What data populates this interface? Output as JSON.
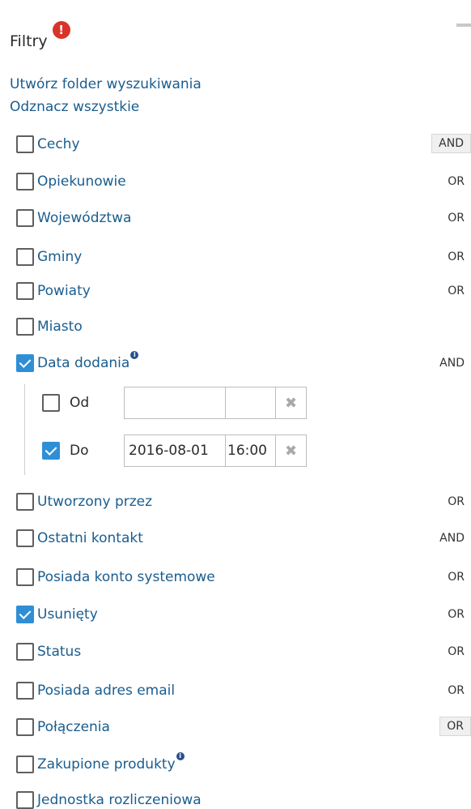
{
  "header": {
    "title": "Filtry",
    "alert_symbol": "!"
  },
  "links": {
    "create_folder": "Utwórz folder wyszukiwania",
    "uncheck_all": "Odznacz wszystkie"
  },
  "filters": [
    {
      "label": "Cechy",
      "checked": false,
      "op": "AND",
      "op_boxed": true
    },
    {
      "label": "Opiekunowie",
      "checked": false,
      "op": "OR"
    },
    {
      "label": "Województwa",
      "checked": false,
      "op": "OR"
    },
    {
      "label": "Gminy",
      "checked": false,
      "op": "OR"
    },
    {
      "label": "Powiaty",
      "checked": false,
      "op": "OR"
    },
    {
      "label": "Miasto",
      "checked": false,
      "op": ""
    },
    {
      "label": "Data dodania",
      "checked": true,
      "op": "AND",
      "info": true
    },
    {
      "label": "Utworzony przez",
      "checked": false,
      "op": "OR"
    },
    {
      "label": "Ostatni kontakt",
      "checked": false,
      "op": "AND"
    },
    {
      "label": "Posiada konto systemowe",
      "checked": false,
      "op": "OR"
    },
    {
      "label": "Usunięty",
      "checked": true,
      "op": "OR"
    },
    {
      "label": "Status",
      "checked": false,
      "op": "OR"
    },
    {
      "label": "Posiada adres email",
      "checked": false,
      "op": "OR"
    },
    {
      "label": "Połączenia",
      "checked": false,
      "op": "OR",
      "op_boxed": true
    },
    {
      "label": "Zakupione produkty",
      "checked": false,
      "op": "",
      "info": true
    },
    {
      "label": "Jednostka rozliczeniowa",
      "checked": false,
      "op": ""
    }
  ],
  "date_range": {
    "from": {
      "label": "Od",
      "checked": false,
      "date": "",
      "time": ""
    },
    "to": {
      "label": "Do",
      "checked": true,
      "date": "2016-08-01",
      "time": "16:00"
    }
  },
  "icons": {
    "clear": "✖",
    "info": "i"
  }
}
